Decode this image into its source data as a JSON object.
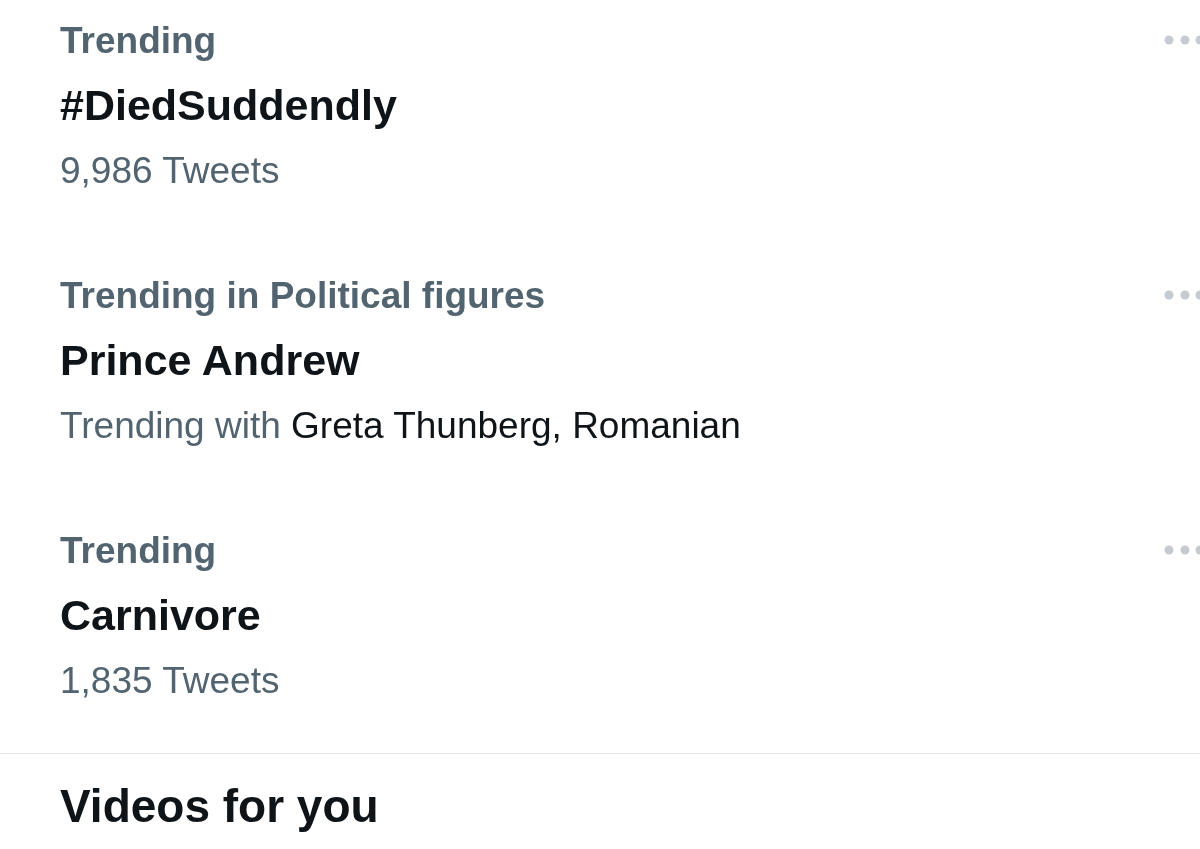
{
  "trends": [
    {
      "kind": "count",
      "category": "Trending",
      "title": "#DiedSuddendly",
      "count": "9,986 Tweets"
    },
    {
      "kind": "related",
      "category": "Trending in Political figures",
      "title": "Prince Andrew",
      "context_label": "Trending with",
      "context_names": "Greta Thunberg, Romanian"
    },
    {
      "kind": "count",
      "category": "Trending",
      "title": "Carnivore",
      "count": "1,835 Tweets"
    }
  ],
  "next_section": {
    "title": "Videos for you"
  }
}
